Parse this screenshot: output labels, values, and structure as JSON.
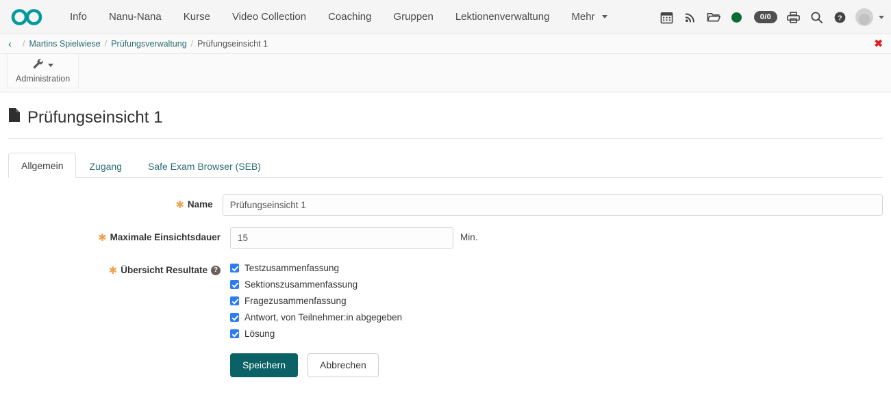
{
  "brand": {
    "logo_icon": "infinity-logo"
  },
  "navbar": {
    "items": [
      {
        "label": "Info"
      },
      {
        "label": "Nanu-Nana"
      },
      {
        "label": "Kurse"
      },
      {
        "label": "Video Collection"
      },
      {
        "label": "Coaching"
      },
      {
        "label": "Gruppen"
      },
      {
        "label": "Lektionenverwaltung"
      },
      {
        "label": "Mehr",
        "has_caret": true
      }
    ],
    "right_icons": [
      {
        "name": "calendar-icon"
      },
      {
        "name": "rss-icon"
      },
      {
        "name": "folder-icon"
      },
      {
        "name": "status-dot-icon",
        "color": "#0a6b34"
      },
      {
        "name": "notification-badge",
        "label": "0/0"
      },
      {
        "name": "printer-icon"
      },
      {
        "name": "search-icon"
      },
      {
        "name": "help-icon"
      },
      {
        "name": "avatar"
      }
    ]
  },
  "breadcrumb": {
    "back_label": "‹",
    "separator": "/",
    "items": [
      {
        "label": "Martins Spielwiese",
        "current": false
      },
      {
        "label": "Prüfungsverwaltung",
        "current": false
      },
      {
        "label": "Prüfungseinsicht 1",
        "current": true
      }
    ],
    "close_label": "✖"
  },
  "toolbar": {
    "administration_label": "Administration",
    "administration_icon": "wrench-icon"
  },
  "page": {
    "title": "Prüfungseinsicht 1",
    "title_icon": "document-icon"
  },
  "tabs": [
    {
      "label": "Allgemein",
      "active": true
    },
    {
      "label": "Zugang",
      "active": false
    },
    {
      "label": "Safe Exam Browser (SEB)",
      "active": false
    }
  ],
  "form": {
    "name": {
      "label": "Name",
      "required_marker": "✱",
      "value": "Prüfungseinsicht 1",
      "placeholder": ""
    },
    "duration": {
      "label": "Maximale Einsichtsdauer",
      "required_marker": "✱",
      "value": "15",
      "placeholder": "",
      "unit": "Min."
    },
    "results_overview": {
      "label": "Übersicht Resultate",
      "required_marker": "✱",
      "help_icon_label": "?",
      "options": [
        {
          "label": "Testzusammenfassung",
          "checked": true
        },
        {
          "label": "Sektionszusammenfassung",
          "checked": true
        },
        {
          "label": "Fragezusammenfassung",
          "checked": true
        },
        {
          "label": "Antwort, von Teilnehmer:in abgegeben",
          "checked": true
        },
        {
          "label": "Lösung",
          "checked": true
        }
      ]
    },
    "buttons": {
      "save_label": "Speichern",
      "cancel_label": "Abbrechen"
    }
  },
  "colors": {
    "brand_teal": "#009a9e",
    "link_teal": "#2b6d73",
    "primary_button": "#0a6166",
    "required_orange": "#f0a253",
    "checkbox_blue": "#2b7cf6",
    "close_red": "#e02020",
    "status_green": "#0a6b34"
  }
}
